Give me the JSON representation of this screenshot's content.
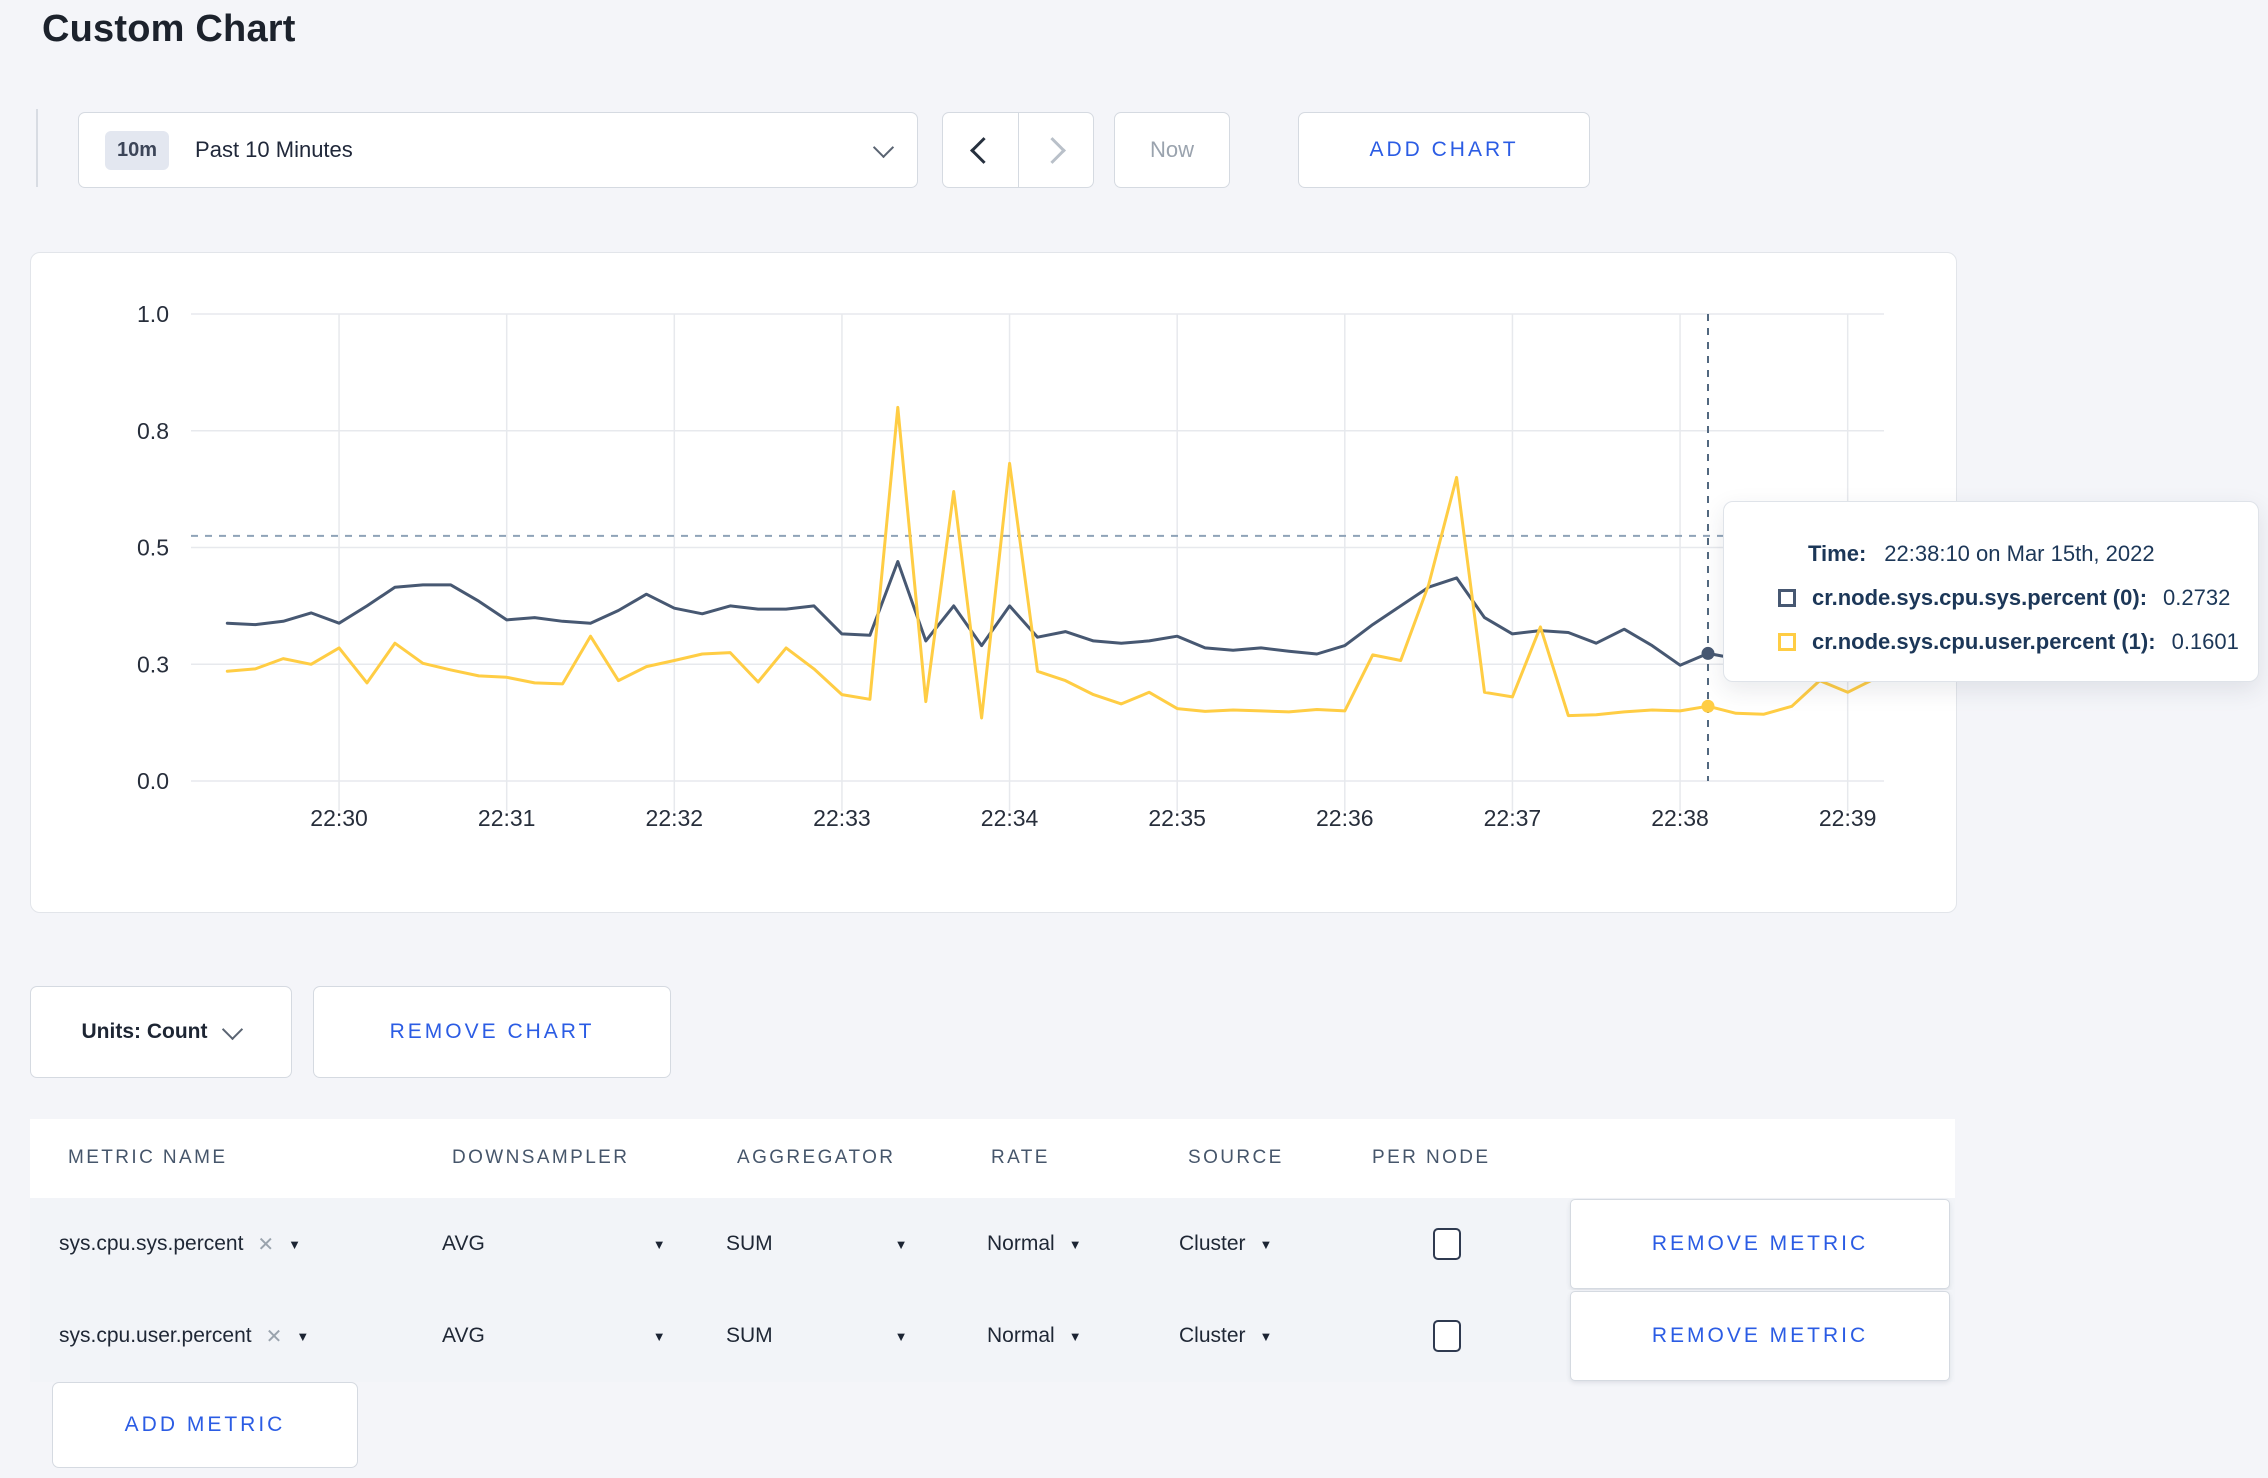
{
  "page": {
    "title": "Custom Chart",
    "background": "#f4f5f9",
    "accent_blue": "#2b5ce4"
  },
  "toolbar": {
    "time_scale_badge": "10m",
    "time_scale_label": "Past 10 Minutes",
    "now_label": "Now",
    "add_chart_label": "ADD CHART"
  },
  "chart_data": {
    "type": "line",
    "title": "",
    "xlabel": "",
    "ylabel": "",
    "ylim": [
      0,
      1
    ],
    "grid": true,
    "legend_position": "tooltip",
    "y_tick_labels": [
      "1.0",
      "0.8",
      "0.5",
      "0.3",
      "0.0"
    ],
    "y_tick_values": [
      1.0,
      0.75,
      0.5,
      0.25,
      0.0
    ],
    "x_ticks": [
      "22:30",
      "22:31",
      "22:32",
      "22:33",
      "22:34",
      "22:35",
      "22:36",
      "22:37",
      "22:38",
      "22:39"
    ],
    "x_start": "22:29:20",
    "interval_seconds": 10,
    "series": [
      {
        "name": "cr.node.sys.cpu.sys.percent (0)",
        "color": "#475872",
        "values": [
          0.338,
          0.335,
          0.342,
          0.36,
          0.338,
          0.375,
          0.415,
          0.42,
          0.42,
          0.385,
          0.345,
          0.35,
          0.342,
          0.338,
          0.365,
          0.4,
          0.37,
          0.358,
          0.375,
          0.368,
          0.368,
          0.375,
          0.315,
          0.312,
          0.47,
          0.3,
          0.375,
          0.29,
          0.375,
          0.308,
          0.32,
          0.3,
          0.295,
          0.3,
          0.31,
          0.285,
          0.28,
          0.285,
          0.278,
          0.272,
          0.29,
          0.335,
          0.375,
          0.415,
          0.435,
          0.35,
          0.315,
          0.322,
          0.318,
          0.295,
          0.325,
          0.29,
          0.248,
          0.2732,
          0.262,
          0.272,
          0.28,
          0.27,
          0.268,
          0.275
        ]
      },
      {
        "name": "cr.node.sys.cpu.user.percent (1)",
        "color": "#FFCD44",
        "values": [
          0.235,
          0.24,
          0.262,
          0.25,
          0.285,
          0.21,
          0.295,
          0.252,
          0.238,
          0.225,
          0.222,
          0.21,
          0.208,
          0.31,
          0.215,
          0.245,
          0.258,
          0.272,
          0.275,
          0.212,
          0.285,
          0.24,
          0.185,
          0.175,
          0.8,
          0.17,
          0.62,
          0.135,
          0.68,
          0.235,
          0.215,
          0.185,
          0.165,
          0.19,
          0.155,
          0.149,
          0.152,
          0.15,
          0.148,
          0.153,
          0.15,
          0.27,
          0.258,
          0.42,
          0.65,
          0.19,
          0.18,
          0.33,
          0.14,
          0.142,
          0.148,
          0.152,
          0.15,
          0.1601,
          0.145,
          0.143,
          0.16,
          0.215,
          0.19,
          0.22
        ]
      }
    ],
    "crosshair": {
      "time": "22:38:10",
      "value_line": 0.525
    }
  },
  "tooltip": {
    "time_label": "Time:",
    "time_value": "22:38:10 on Mar 15th, 2022",
    "rows": [
      {
        "name": "cr.node.sys.cpu.sys.percent (0):",
        "value": "0.2732",
        "color": "#475872"
      },
      {
        "name": "cr.node.sys.cpu.user.percent (1):",
        "value": "0.1601",
        "color": "#FFCD44"
      }
    ]
  },
  "chart_controls": {
    "units_label": "Units: Count",
    "remove_chart_label": "REMOVE CHART"
  },
  "metrics_table": {
    "headers": [
      "METRIC NAME",
      "DOWNSAMPLER",
      "AGGREGATOR",
      "RATE",
      "SOURCE",
      "PER NODE"
    ],
    "rows": [
      {
        "metric": "sys.cpu.sys.percent",
        "downsampler": "AVG",
        "aggregator": "SUM",
        "rate": "Normal",
        "source": "Cluster",
        "per_node_checked": false,
        "remove_label": "REMOVE METRIC"
      },
      {
        "metric": "sys.cpu.user.percent",
        "downsampler": "AVG",
        "aggregator": "SUM",
        "rate": "Normal",
        "source": "Cluster",
        "per_node_checked": false,
        "remove_label": "REMOVE METRIC"
      }
    ],
    "add_metric_label": "ADD METRIC"
  }
}
